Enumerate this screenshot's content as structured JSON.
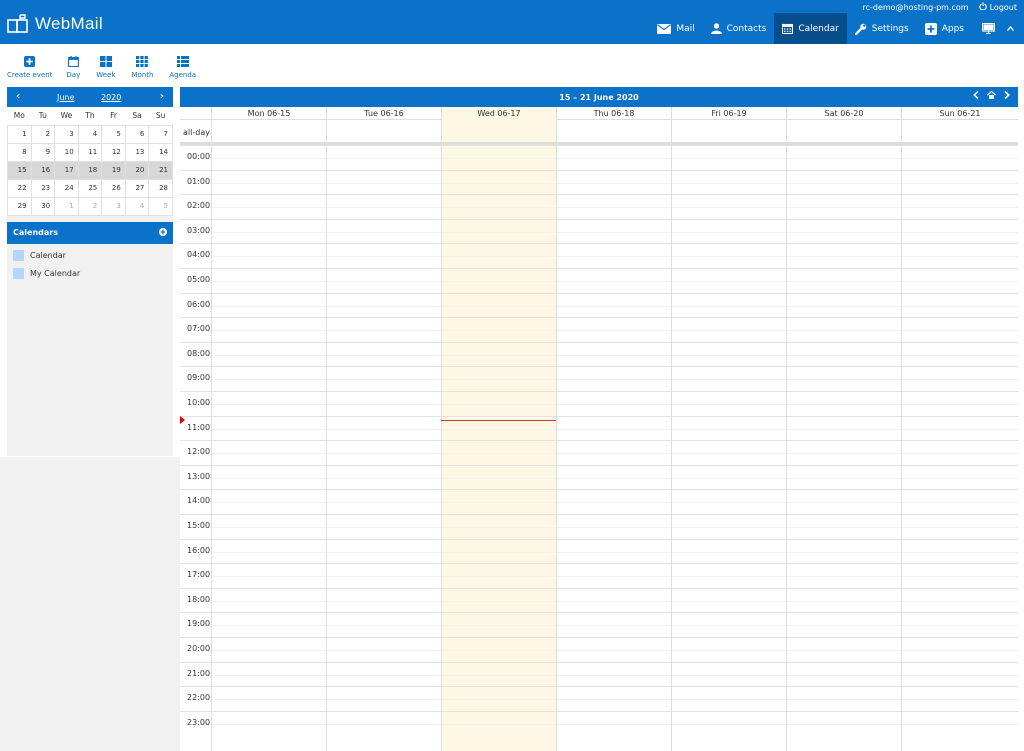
{
  "app": {
    "title": "WebMail"
  },
  "user": {
    "email": "rc-demo@hosting-pm.com",
    "logout_label": "Logout"
  },
  "nav": [
    {
      "label": "Mail",
      "icon": "envelope-icon",
      "active": false
    },
    {
      "label": "Contacts",
      "icon": "user-icon",
      "active": false
    },
    {
      "label": "Calendar",
      "icon": "calendar-icon",
      "active": true
    },
    {
      "label": "Settings",
      "icon": "wrench-icon",
      "active": false
    },
    {
      "label": "Apps",
      "icon": "plus-square-icon",
      "active": false
    }
  ],
  "toolbar": {
    "create_event": "Create event",
    "day": "Day",
    "week": "Week",
    "month": "Month",
    "agenda": "Agenda"
  },
  "minical": {
    "month": "June",
    "year": "2020",
    "prev": "‹",
    "next": "›",
    "weekdays": [
      "Mo",
      "Tu",
      "We",
      "Th",
      "Fr",
      "Sa",
      "Su"
    ],
    "weeks": [
      [
        "1",
        "2",
        "3",
        "4",
        "5",
        "6",
        "7"
      ],
      [
        "8",
        "9",
        "10",
        "11",
        "12",
        "13",
        "14"
      ],
      [
        "15",
        "16",
        "17",
        "18",
        "19",
        "20",
        "21"
      ],
      [
        "22",
        "23",
        "24",
        "25",
        "26",
        "27",
        "28"
      ],
      [
        "29",
        "30",
        "1",
        "2",
        "3",
        "4",
        "5"
      ]
    ]
  },
  "calendars": {
    "heading": "Calendars",
    "items": [
      {
        "label": "Calendar",
        "color": "#b3d5f7"
      },
      {
        "label": "My Calendar",
        "color": "#b3d5f7"
      }
    ]
  },
  "week": {
    "title": "15 – 21 June 2020",
    "allday_label": "all-day",
    "days": [
      "Mon 06-15",
      "Tue 06-16",
      "Wed 06-17",
      "Thu 06-18",
      "Fri 06-19",
      "Sat 06-20",
      "Sun 06-21"
    ],
    "hours": [
      "00:00",
      "01:00",
      "02:00",
      "03:00",
      "04:00",
      "05:00",
      "06:00",
      "07:00",
      "08:00",
      "09:00",
      "10:00",
      "11:00",
      "12:00",
      "13:00",
      "14:00",
      "15:00",
      "16:00",
      "17:00",
      "18:00",
      "19:00",
      "20:00",
      "21:00",
      "22:00",
      "23:00"
    ]
  },
  "colors": {
    "accent": "#0a72c9",
    "accent_dark": "#074e8c",
    "today_bg": "#fcf8e3",
    "now_line": "#e03030"
  }
}
